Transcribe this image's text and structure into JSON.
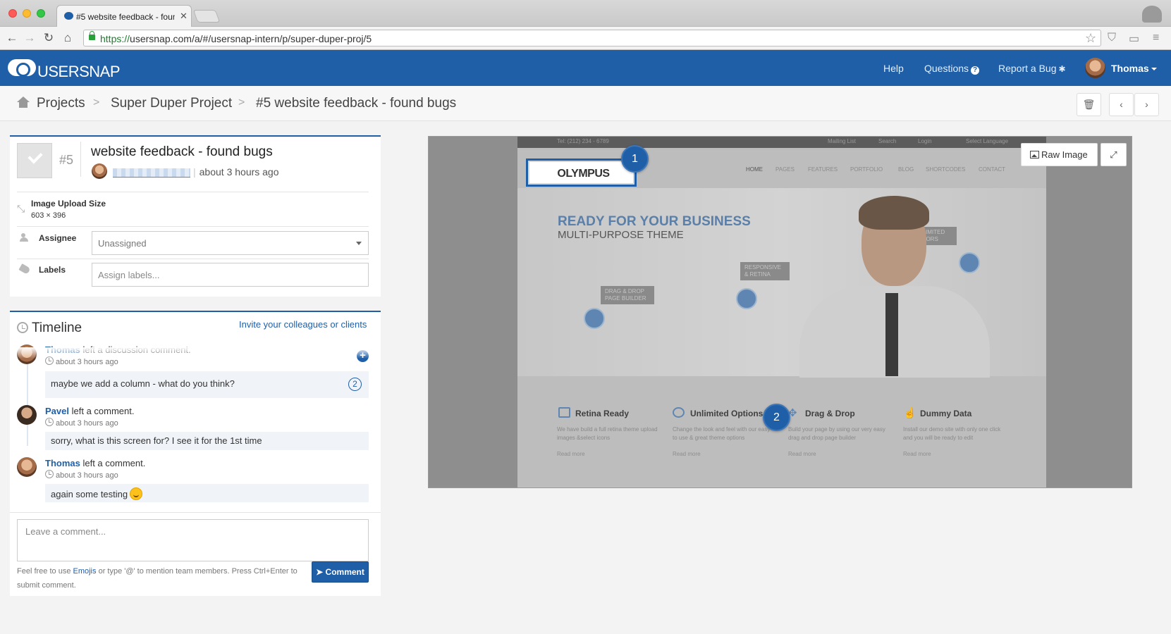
{
  "browser": {
    "tab_title": "#5 website feedback - found bugs",
    "url_secure": "https://",
    "url_rest": "usersnap.com/a/#/usersnap-intern/p/super-duper-proj/5"
  },
  "header": {
    "logo_text": "USERSNAP",
    "nav": {
      "help": "Help",
      "questions": "Questions",
      "report_bug": "Report a Bug"
    },
    "user_name": "Thomas"
  },
  "breadcrumb": {
    "projects": "Projects",
    "project": "Super Duper Project",
    "issue": "#5 website feedback - found bugs",
    "separator": ">"
  },
  "issue": {
    "number": "#5",
    "title": "website feedback - found bugs",
    "time": "about 3 hours ago",
    "meta": {
      "size_label": "Image Upload Size",
      "size_value": "603 × 396",
      "assignee_label": "Assignee",
      "assignee_value": "Unassigned",
      "labels_label": "Labels",
      "labels_placeholder": "Assign labels..."
    }
  },
  "timeline": {
    "heading": "Timeline",
    "invite": "Invite your colleagues or clients",
    "entries": [
      {
        "author": "Thomas",
        "action": "left a discussion comment.",
        "time": "about 3 hours ago",
        "text": "maybe we add a column - what do you think?",
        "marker": "2"
      },
      {
        "author": "Pavel",
        "action": "left a comment.",
        "time": "about 3 hours ago",
        "text": "sorry, what is this screen for? I see it for the 1st time"
      },
      {
        "author": "Thomas",
        "action": "left a comment.",
        "time": "about 3 hours ago",
        "text": "again some testing"
      }
    ],
    "comment_placeholder": "Leave a comment...",
    "help_pre": "Feel free to use",
    "help_link": "Emojis",
    "help_post": "or type '@' to mention team members. Press Ctrl+Enter to submit comment.",
    "comment_button": "Comment"
  },
  "screenshot": {
    "raw_image_label": "Raw Image",
    "pins": [
      "1",
      "2"
    ],
    "site": {
      "topbar_phone": "Tel: (212) 234 - 6789",
      "topbar_links": [
        "Mailing List",
        "Search",
        "Login",
        "Select Language"
      ],
      "logo": "OLYMPUS",
      "nav": [
        "HOME",
        "PAGES",
        "FEATURES",
        "PORTFOLIO",
        "BLOG",
        "SHORTCODES",
        "CONTACT"
      ],
      "hero_title": "READY FOR YOUR BUSINESS",
      "hero_sub": "MULTI-PURPOSE THEME",
      "hero_labels": [
        "DRAG & DROP PAGE BUILDER",
        "RESPONSIVE & RETINA",
        "UNLIMITED COLORS"
      ],
      "features": [
        {
          "title": "Retina Ready",
          "text": "We have build a full retina theme upload images &select icons",
          "more": "Read more"
        },
        {
          "title": "Unlimited Options",
          "text": "Change the look and feel with our easy to use & great theme options",
          "more": "Read more"
        },
        {
          "title": "Drag & Drop",
          "text": "Build your page by using our very easy drag and drop page builder",
          "more": "Read more"
        },
        {
          "title": "Dummy Data",
          "text": "Install our demo site with only one click and you will be ready to edit",
          "more": "Read more"
        }
      ]
    }
  },
  "colors": {
    "brand": "#1f5fa8",
    "background": "#f3f3f3"
  }
}
